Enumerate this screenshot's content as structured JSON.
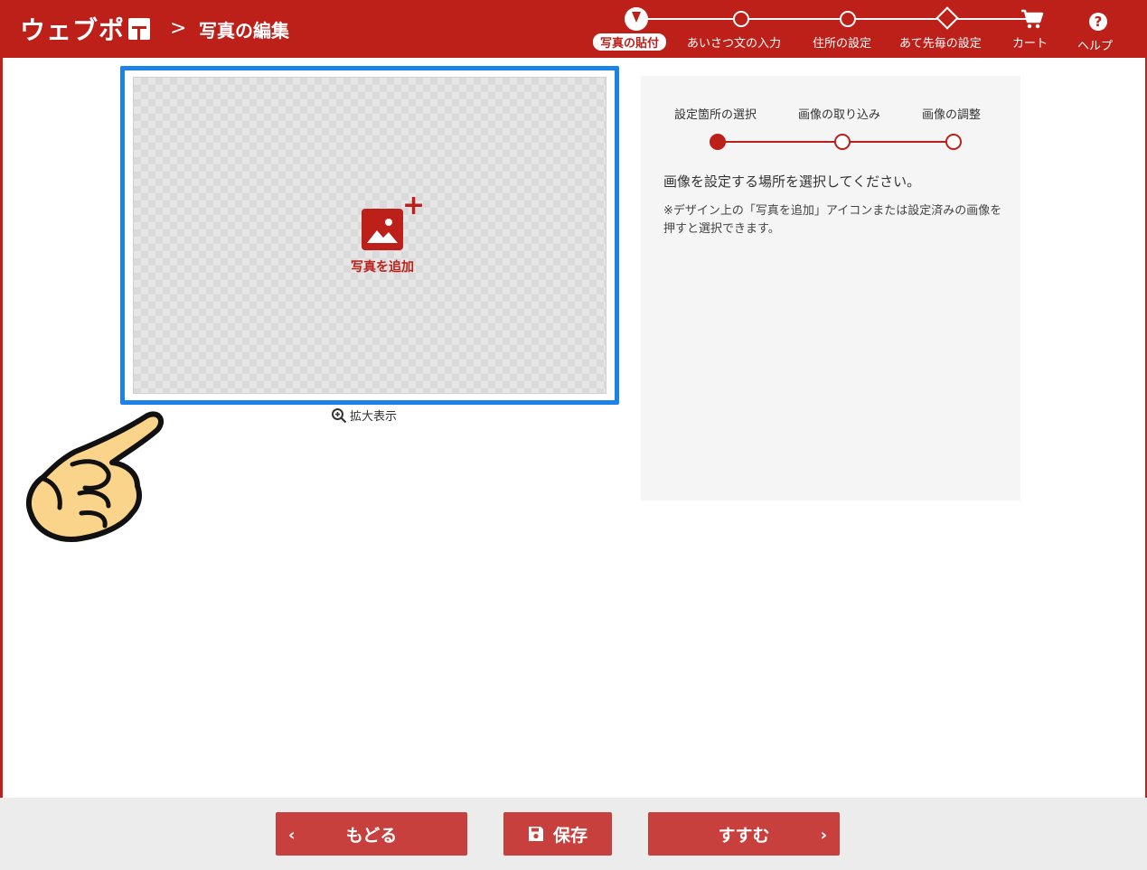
{
  "header": {
    "logo": "ウェブポ",
    "separator": ">",
    "title": "写真の編集",
    "steps": [
      {
        "label": "写真の貼付",
        "state": "active"
      },
      {
        "label": "あいさつ文の入力",
        "state": "pending"
      },
      {
        "label": "住所の設定",
        "state": "pending"
      },
      {
        "label": "あて先毎の設定",
        "state": "pending"
      },
      {
        "label": "カート",
        "icon": "cart-icon"
      }
    ],
    "help_icon_glyph": "?",
    "help_label": "ヘルプ"
  },
  "canvas": {
    "add_photo_label": "写真を追加",
    "plus_glyph": "+",
    "zoom_label": "拡大表示"
  },
  "panel": {
    "substeps": [
      {
        "label": "設定箇所の選択",
        "state": "active"
      },
      {
        "label": "画像の取り込み",
        "state": "pending"
      },
      {
        "label": "画像の調整",
        "state": "pending"
      }
    ],
    "instruction": "画像を設定する場所を選択してください。",
    "note": "※デザイン上の「写真を追加」アイコンまたは設定済みの画像を押すと選択できます。"
  },
  "footer": {
    "back_label": "もどる",
    "save_label": "保存",
    "next_label": "すすむ",
    "chevron_left": "‹",
    "chevron_right": "›"
  },
  "colors": {
    "brand_red": "#bd1f19",
    "button_red": "#c8403d",
    "selection_blue": "#1a82e8"
  }
}
